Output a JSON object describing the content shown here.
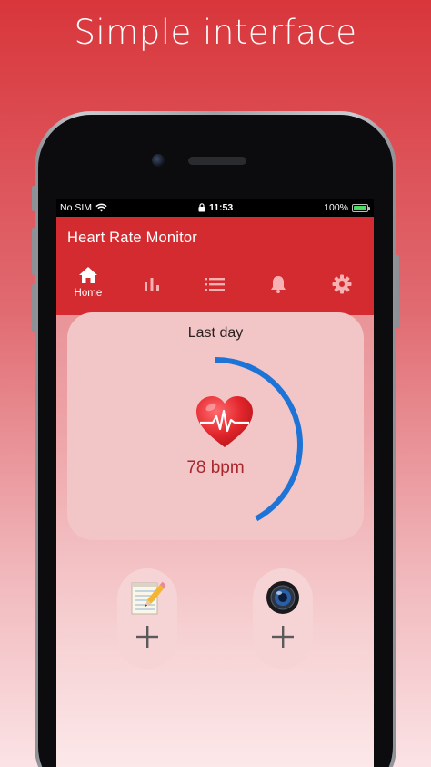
{
  "headline": "Simple interface",
  "status_bar": {
    "carrier": "No SIM",
    "time": "11:53",
    "battery": "100%"
  },
  "app": {
    "title": "Heart Rate Monitor",
    "tabs": [
      {
        "label": "Home",
        "icon": "home-icon",
        "active": true
      },
      {
        "label": "",
        "icon": "bar-chart-icon",
        "active": false
      },
      {
        "label": "",
        "icon": "list-icon",
        "active": false
      },
      {
        "label": "",
        "icon": "bell-icon",
        "active": false
      },
      {
        "label": "",
        "icon": "gear-icon",
        "active": false
      }
    ]
  },
  "summary_card": {
    "title": "Last day",
    "value": "78 bpm",
    "gauge_fraction": 0.42
  },
  "actions": [
    {
      "icon": "notepad-pencil-icon",
      "plus": "+"
    },
    {
      "icon": "camera-lens-icon",
      "plus": "+"
    }
  ],
  "colors": {
    "primary": "#d42b30",
    "gauge": "#1e73d6",
    "bpm_text": "#a8262c",
    "card": "#f2c5c7"
  }
}
